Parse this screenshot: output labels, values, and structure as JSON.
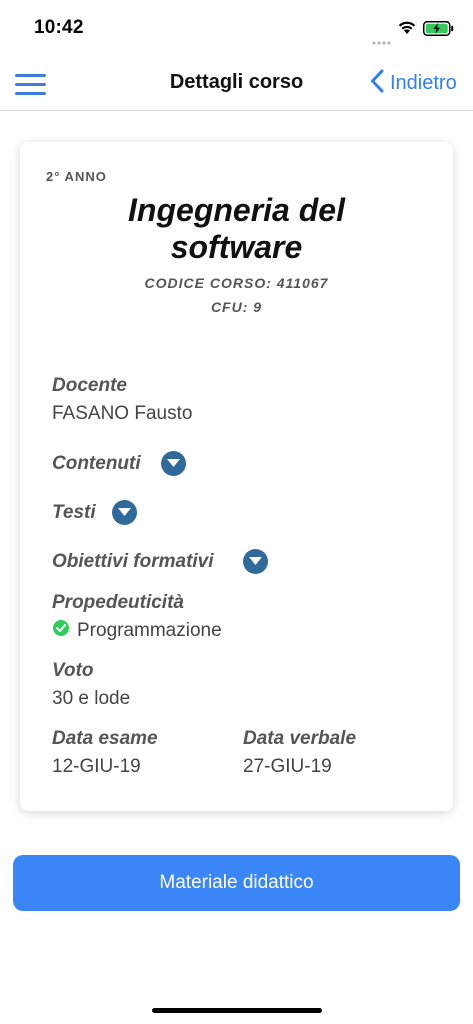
{
  "status_bar": {
    "time": "10:42",
    "icons": [
      "signal-icon",
      "wifi-icon",
      "battery-charging-icon"
    ]
  },
  "nav": {
    "title": "Dettagli corso",
    "back_label": "Indietro",
    "menu_icon": "hamburger-menu-icon",
    "back_icon": "chevron-left-icon",
    "accent_color": "#2f80ed"
  },
  "course": {
    "year": "2° ANNO",
    "title": "Ingegneria del software",
    "code": "CODICE CORSO: 411067",
    "cfu": "CFU: 9"
  },
  "details": {
    "teacher_label": "Docente",
    "teacher_value": "FASANO Fausto",
    "contents_label": "Contenuti",
    "texts_label": "Testi",
    "objectives_label": "Obiettivi formativi",
    "prerequisites_label": "Propedeuticità",
    "prerequisites_value": "Programmazione",
    "grade_label": "Voto",
    "grade_value": "30 e lode",
    "exam_date_label": "Data esame",
    "exam_date_value": "12-GIU-19",
    "record_date_label": "Data verbale",
    "record_date_value": "27-GIU-19"
  },
  "actions": {
    "material_button": "Materiale didattico",
    "button_color": "#3b86f6",
    "expand_color": "#2f6a9b",
    "check_color": "#2ecc5a"
  }
}
